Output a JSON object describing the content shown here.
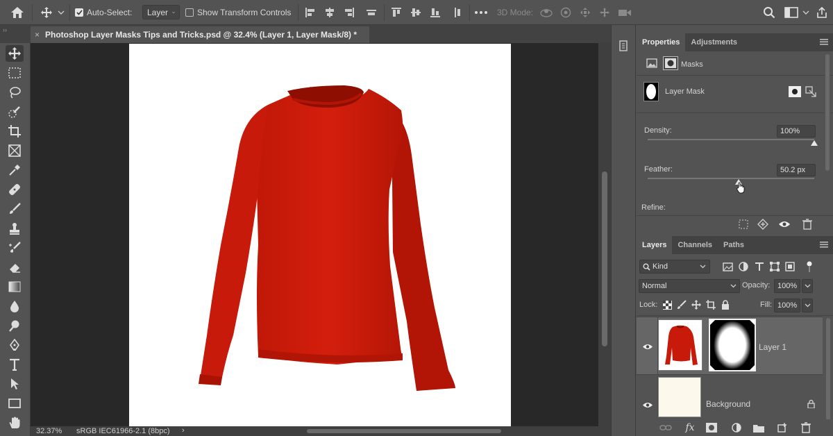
{
  "options_bar": {
    "auto_select_label": "Auto-Select:",
    "auto_select_checked": true,
    "layer_dropdown_value": "Layer",
    "show_transform_label": "Show Transform Controls",
    "show_transform_checked": false,
    "mode_3d_label": "3D Mode:"
  },
  "document": {
    "tab_title": "Photoshop Layer Masks Tips and Tricks.psd @ 32.4% (Layer 1, Layer Mask/8) *",
    "close_glyph": "×"
  },
  "status_bar": {
    "zoom": "32.37%",
    "color_profile": "sRGB IEC61966-2.1 (8bpc)",
    "arrow": "›"
  },
  "properties_panel": {
    "tabs": [
      "Properties",
      "Adjustments"
    ],
    "masks_label": "Masks",
    "layer_mask_label": "Layer Mask",
    "density_label": "Density:",
    "density_value": "100%",
    "density_percent": 100,
    "feather_label": "Feather:",
    "feather_value": "50.2 px",
    "refine_label": "Refine:"
  },
  "layers_panel": {
    "tabs": [
      "Layers",
      "Channels",
      "Paths"
    ],
    "kind_label": "Kind",
    "blend_mode": "Normal",
    "opacity_label": "Opacity:",
    "opacity_value": "100%",
    "lock_label": "Lock:",
    "fill_label": "Fill:",
    "fill_value": "100%",
    "layers": [
      {
        "name": "Layer 1",
        "visible": true,
        "selected": true,
        "has_mask": true
      },
      {
        "name": "Background",
        "visible": true,
        "selected": false,
        "locked": true
      }
    ],
    "footer_fx": "fx"
  },
  "colors": {
    "ui_gray": "#535353",
    "dark_gray": "#424242",
    "canvas_bg": "#282828",
    "sweater_red": "#d21c0c",
    "layer_selected": "#666666"
  },
  "icons": {
    "options_bar": [
      "home-icon",
      "move-tool-icon",
      "chevron-down-icon",
      "align-left-icon",
      "align-center-h-icon",
      "align-right-icon",
      "distribute-icon",
      "align-top-icon",
      "align-middle-v-icon",
      "align-bottom-icon",
      "distribute-v-icon",
      "more-icon",
      "orbit-3d-icon",
      "roll-3d-icon",
      "drag-3d-icon",
      "slide-3d-icon",
      "scale-3d-icon",
      "search-icon",
      "workspace-icon",
      "share-icon"
    ],
    "tools": [
      "move-tool-icon",
      "marquee-tool-icon",
      "lasso-tool-icon",
      "quick-select-tool-icon",
      "crop-tool-icon",
      "frame-tool-icon",
      "eyedropper-tool-icon",
      "healing-tool-icon",
      "brush-tool-icon",
      "stamp-tool-icon",
      "history-brush-tool-icon",
      "eraser-tool-icon",
      "gradient-tool-icon",
      "blur-tool-icon",
      "dodge-tool-icon",
      "pen-tool-icon",
      "type-tool-icon",
      "path-select-tool-icon",
      "rectangle-tool-icon",
      "hand-tool-icon"
    ]
  }
}
